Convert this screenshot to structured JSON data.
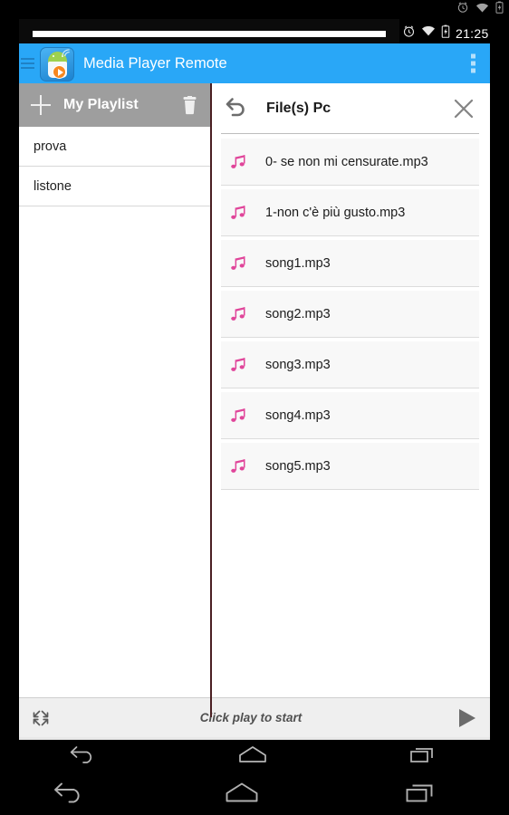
{
  "status_bar": {
    "time": "21:25",
    "icons": [
      "alarm-icon",
      "wifi-icon",
      "battery-icon"
    ]
  },
  "app_bar": {
    "title": "Media Player Remote",
    "menu_icon": "hamburger-menu-icon",
    "logo_icon": "app-logo-icon",
    "overflow_icon": "overflow-menu-icon",
    "background_color": "#29a7f7"
  },
  "playlist_panel": {
    "header_title": "My Playlist",
    "add_icon": "plus-icon",
    "delete_icon": "trash-icon",
    "header_background": "#9e9e9e",
    "items": [
      {
        "label": "prova"
      },
      {
        "label": "listone"
      }
    ]
  },
  "files_panel": {
    "title": "File(s)  Pc",
    "back_icon": "undo-arrow-icon",
    "close_icon": "close-x-icon",
    "note_icon_color": "#e0459a",
    "files": [
      {
        "name": "0- se non mi censurate.mp3"
      },
      {
        "name": "1-non c'è più gusto.mp3"
      },
      {
        "name": "song1.mp3"
      },
      {
        "name": "song2.mp3"
      },
      {
        "name": "song3.mp3"
      },
      {
        "name": "song4.mp3"
      },
      {
        "name": "song5.mp3"
      }
    ]
  },
  "player_bar": {
    "status_text": "Click play to start",
    "expand_icon": "fullscreen-expand-icon",
    "play_icon": "play-icon"
  },
  "nav_bar": {
    "buttons": [
      {
        "icon": "back-icon"
      },
      {
        "icon": "home-icon"
      },
      {
        "icon": "recents-icon"
      }
    ]
  }
}
